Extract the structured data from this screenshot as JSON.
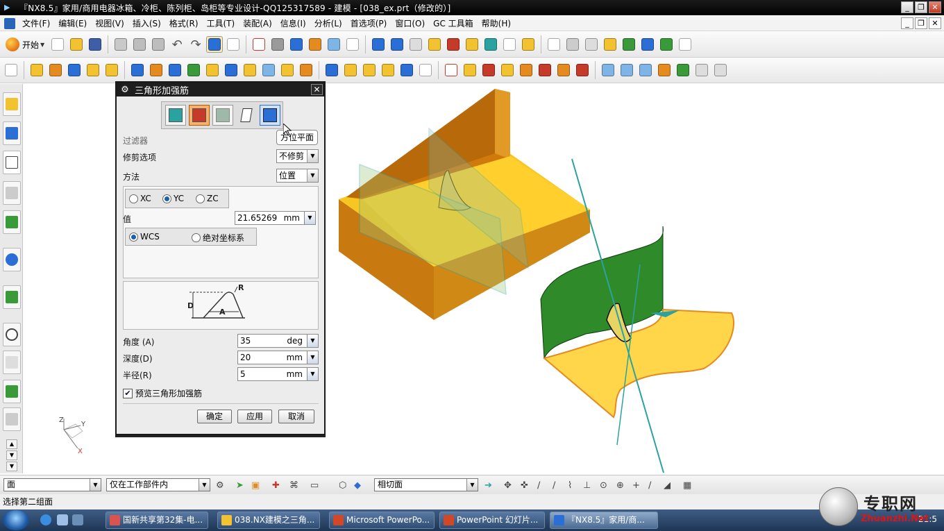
{
  "window": {
    "title": "『NX8.5』家用/商用电器冰箱、冷柜、陈列柜、岛柜等专业设计-QQ125317589 - 建模 - [038_ex.prt（修改的）]",
    "controls": [
      "_",
      "❐",
      "✕"
    ]
  },
  "menubar": {
    "items": [
      "文件(F)",
      "编辑(E)",
      "视图(V)",
      "插入(S)",
      "格式(R)",
      "工具(T)",
      "装配(A)",
      "信息(I)",
      "分析(L)",
      "首选项(P)",
      "窗口(O)",
      "GC 工具箱",
      "帮助(H)"
    ],
    "mdi_controls": [
      "_",
      "❐",
      "✕"
    ]
  },
  "toolbar": {
    "start_label": "开始",
    "colors": {
      "blue": "#2b6fd6",
      "yellow": "#f2c230",
      "green": "#3a9a3a",
      "orange": "#e58a1f",
      "gray": "#9a9a9a",
      "teal": "#2aa3a0",
      "red": "#c63a2a"
    }
  },
  "dialog": {
    "title": "三角形加强筋",
    "type_buttons": [
      "rib-face-icon",
      "rib-placement-icon",
      "rib-surface-icon",
      "rib-plane-icon",
      "orientation-plane-icon"
    ],
    "tooltip": "方位平面",
    "filter_label": "过滤器",
    "trim_label": "修剪选项",
    "trim_value": "不修剪",
    "method_label": "方法",
    "method_value": "位置",
    "axis_options": [
      "XC",
      "YC",
      "ZC"
    ],
    "axis_selected": "YC",
    "value_label": "值",
    "value_number": "21.65269",
    "value_unit": "mm",
    "coord_options": [
      "WCS",
      "绝对坐标系"
    ],
    "coord_selected": "WCS",
    "diagram_labels": {
      "d": "D",
      "r": "R",
      "a": "A"
    },
    "angle_label": "角度 (A)",
    "angle_value": "35",
    "angle_unit": "deg",
    "depth_label": "深度(D)",
    "depth_value": "20",
    "depth_unit": "mm",
    "radius_label": "半径(R)",
    "radius_value": "5",
    "radius_unit": "mm",
    "preview_label": "预览三角形加强筋",
    "preview_checked": true,
    "ok_label": "确定",
    "apply_label": "应用",
    "cancel_label": "取消"
  },
  "triad": {
    "x": "X",
    "y": "Y",
    "z": "Z"
  },
  "selection_bar": {
    "filter_type": "面",
    "scope": "仅在工作部件内",
    "intersection": "相切面"
  },
  "status": {
    "prompt": "选择第二组面"
  },
  "taskbar": {
    "tasks": [
      "国新共享第32集-电...",
      "038.NX建模之三角...",
      "Microsoft PowerPo...",
      "PowerPoint 幻灯片...",
      "『NX8.5』家用/商..."
    ],
    "clock": "21:5"
  },
  "watermark": {
    "text": "专职网",
    "url": "Zhuanzhi.Net"
  }
}
